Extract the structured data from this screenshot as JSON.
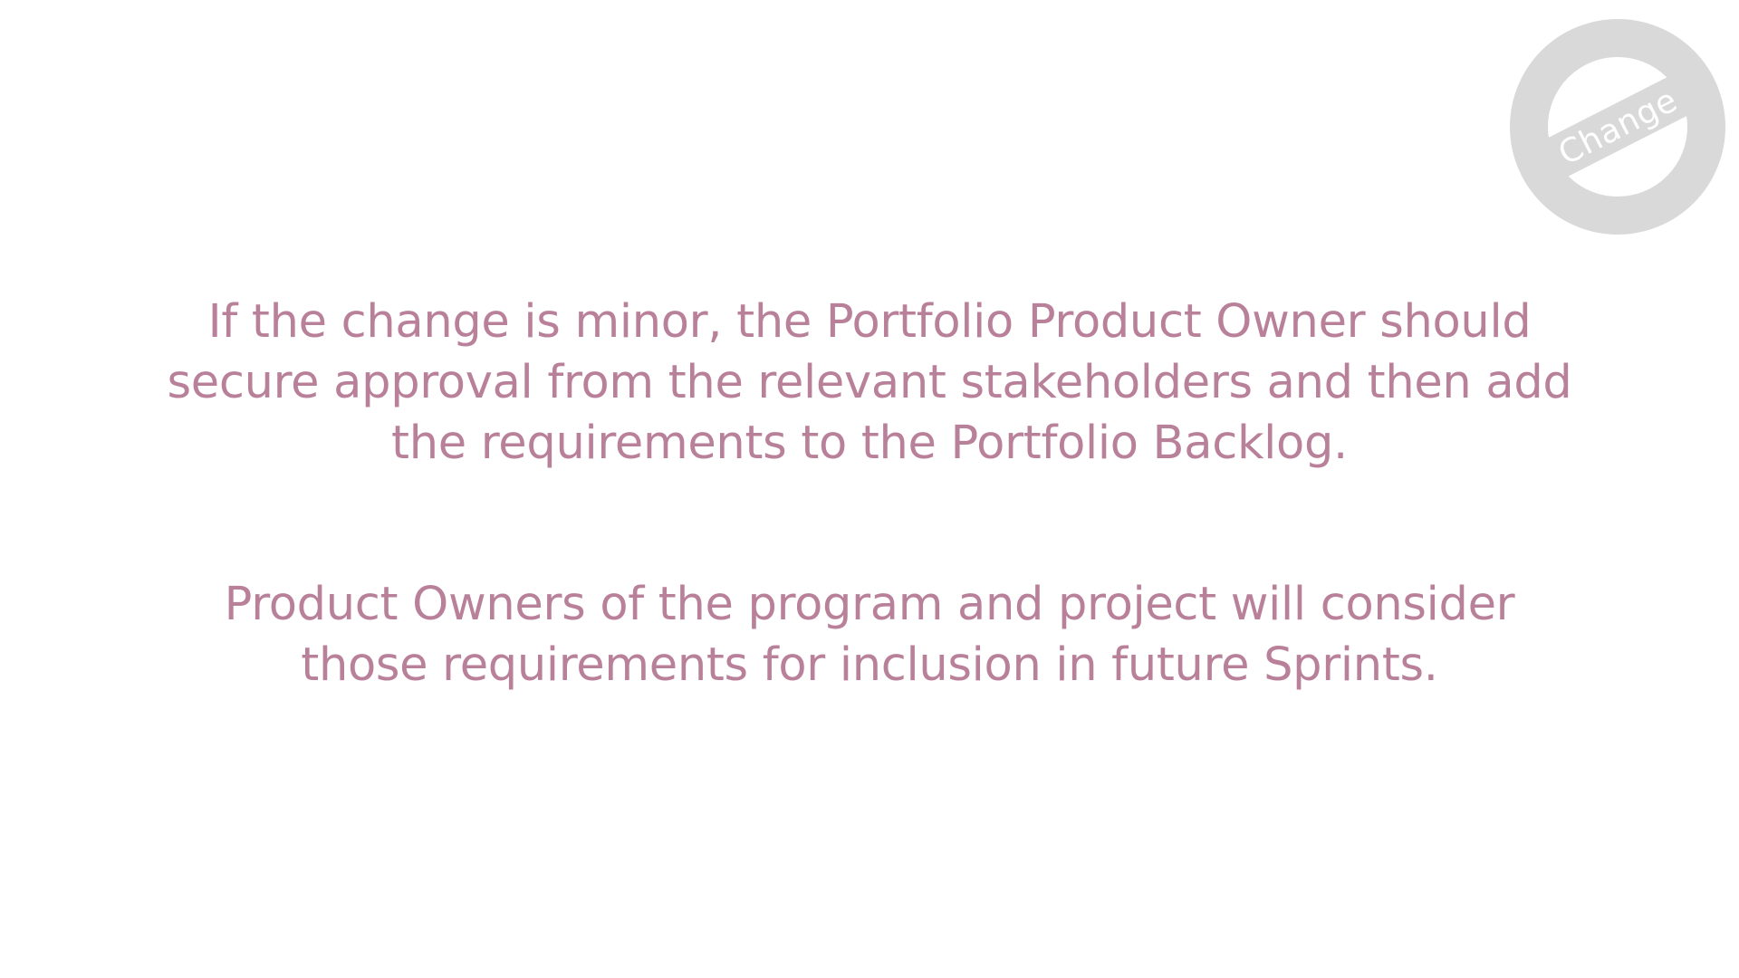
{
  "badge": {
    "label": "Change",
    "ring_color": "#d9d9d9",
    "band_color": "#d9d9d9",
    "text_color": "#ffffff"
  },
  "content": {
    "paragraph_1": "If the change is minor, the Portfolio Product Owner should secure approval from the relevant stakeholders and then add the requirements to the Portfolio Backlog.",
    "paragraph_2": "Product Owners of the program and project will consider those requirements for inclusion in future Sprints.",
    "text_color": "#b9809a"
  }
}
